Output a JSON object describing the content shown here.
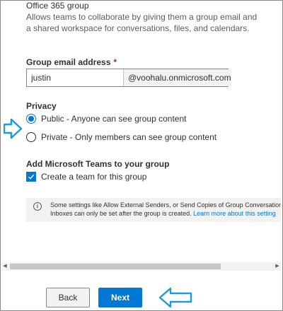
{
  "group": {
    "title": "Office 365 group",
    "description": "Allows teams to collaborate by giving them a group email and a shared workspace for conversations, files, and calendars."
  },
  "email": {
    "label": "Group email address",
    "required_mark": "*",
    "value": "justin",
    "domain_suffix": "@voohalu.onmicrosoft.com"
  },
  "privacy": {
    "label": "Privacy",
    "options": [
      {
        "label": "Public - Anyone can see group content",
        "selected": true
      },
      {
        "label": "Private - Only members can see group content",
        "selected": false
      }
    ]
  },
  "teams": {
    "label": "Add Microsoft Teams to your group",
    "checkbox_label": "Create a team for this group",
    "checked": true
  },
  "info": {
    "line1": "Some settings like Allow External Senders, or Send Copies of Group Conversations",
    "line2": "Inboxes can only be set after the group is created.",
    "link": "Learn more about this setting"
  },
  "footer": {
    "back_label": "Back",
    "next_label": "Next"
  },
  "colors": {
    "accent": "#0078d4",
    "callout_arrow": "#1a9cd8"
  },
  "icons": {
    "info": "info-icon",
    "checkmark": "checkmark-icon",
    "callout": "arrow-callout-icon"
  }
}
